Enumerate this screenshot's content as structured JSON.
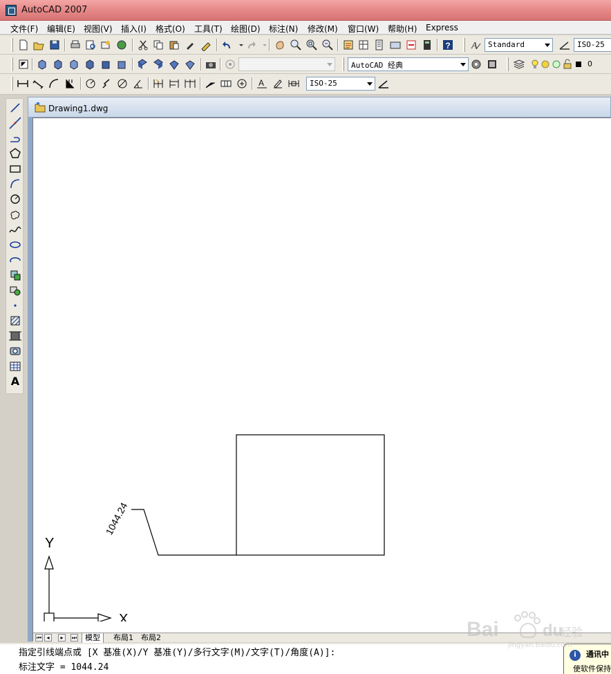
{
  "window": {
    "title": "AutoCAD 2007"
  },
  "menu": [
    "文件(F)",
    "编辑(E)",
    "视图(V)",
    "插入(I)",
    "格式(O)",
    "工具(T)",
    "绘图(D)",
    "标注(N)",
    "修改(M)",
    "窗口(W)",
    "帮助(H)",
    "Express"
  ],
  "toolbar": {
    "text_style": "Standard",
    "dim_style": "ISO-25",
    "workspace": "AutoCAD 经典",
    "layer": "0",
    "view_combo": "",
    "dim_style_bottom": "ISO-25"
  },
  "document": {
    "tab_title": "Drawing1.dwg"
  },
  "drawing": {
    "dimension_text": "1044.24",
    "ucs_x_label": "X",
    "ucs_y_label": "Y"
  },
  "layout_tabs": {
    "model": "模型",
    "layout1": "布局1",
    "layout2": "布局2"
  },
  "command": {
    "line1": "指定引线端点或 [X 基准(X)/Y 基准(Y)/多行文字(M)/文字(T)/角度(A)]:",
    "line2": "标注文字 = 1044.24"
  },
  "balloon": {
    "icon": "communication-center-icon",
    "title": "通讯中",
    "text": "使软件保持"
  },
  "watermark": {
    "brand": "Bai",
    "brand2": "du",
    "suffix": "经验",
    "url": "jingyan.baidu.com"
  }
}
